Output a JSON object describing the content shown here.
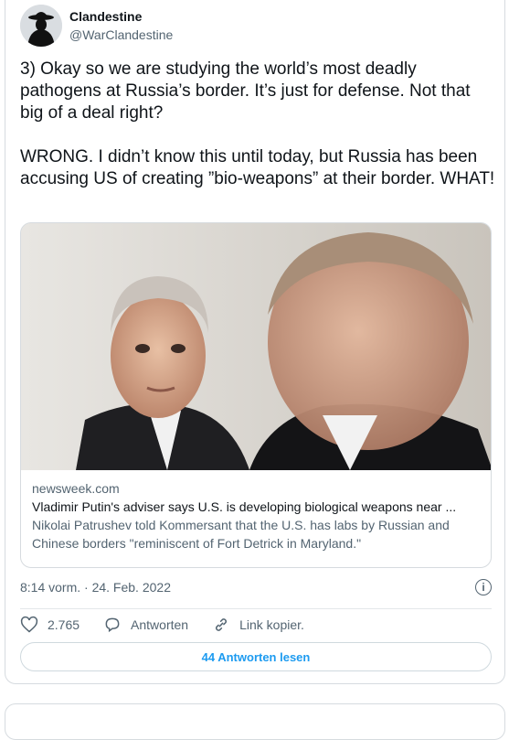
{
  "tweet": {
    "display_name": "Clandestine",
    "handle": "@WarClandestine",
    "text": "3) Okay so we are studying the world’s most deadly pathogens at Russia’s border. It’s just for defense. Not that big of a deal right?\n\nWRONG. I didn’t know this until today, but Russia has been accusing US of creating ”bio-weapons” at their border. WHAT!",
    "timestamp": "8:14 vorm. · 24. Feb. 2022"
  },
  "link_card": {
    "domain": "newsweek.com",
    "title": "Vladimir Putin's adviser says U.S. is developing biological weapons near ...",
    "description": "Nikolai Patrushev told Kommersant that the U.S. has labs by Russian and Chinese borders \"reminiscent of Fort Detrick in Maryland.\""
  },
  "actions": {
    "like_count": "2.765",
    "reply_label": "Antworten",
    "copy_link_label": "Link kopier."
  },
  "read_replies_label": "44 Antworten lesen",
  "icons": {
    "info": "info-icon",
    "like": "heart-icon",
    "reply": "reply-icon",
    "link": "link-icon"
  },
  "colors": {
    "accent": "#1d9bf0",
    "muted": "#536471"
  }
}
